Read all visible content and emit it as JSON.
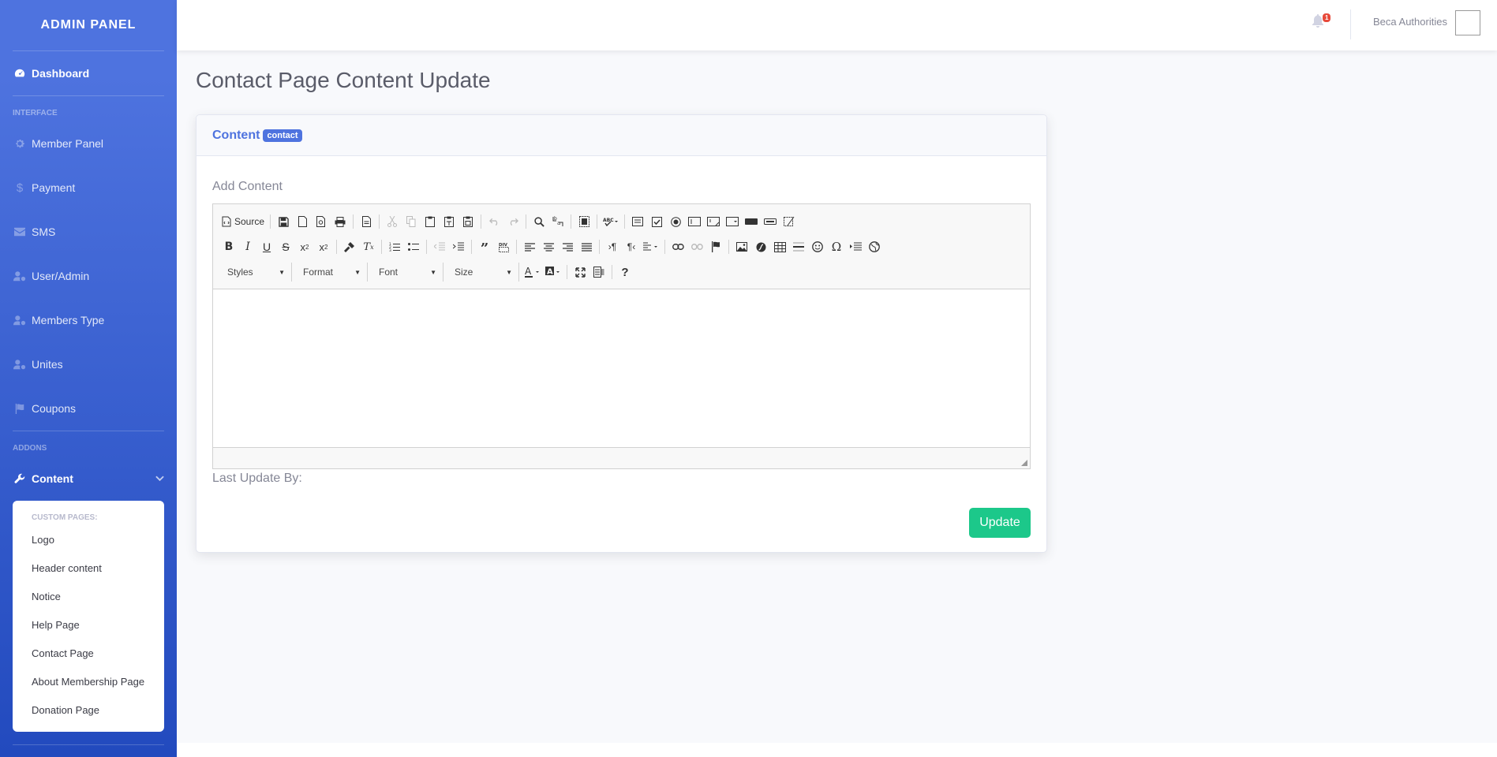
{
  "sidebar": {
    "brand": "ADMIN PANEL",
    "dashboard": "Dashboard",
    "heading_interface": "INTERFACE",
    "items": [
      {
        "label": "Member Panel",
        "icon": "gear-icon"
      },
      {
        "label": "Payment",
        "icon": "dollar-icon"
      },
      {
        "label": "SMS",
        "icon": "envelope-icon"
      },
      {
        "label": "User/Admin",
        "icon": "user-cog-icon"
      },
      {
        "label": "Members Type",
        "icon": "user-cog-icon"
      },
      {
        "label": "Unites",
        "icon": "user-cog-icon"
      },
      {
        "label": "Coupons",
        "icon": "flag-icon"
      }
    ],
    "heading_addons": "ADDONS",
    "content": "Content",
    "collapse": {
      "header": "CUSTOM PAGES:",
      "items": [
        "Logo",
        "Header content",
        "Notice",
        "Help Page",
        "Contact Page",
        "About Membership Page",
        "Donation Page"
      ]
    }
  },
  "topbar": {
    "badge_count": "1",
    "username": "Beca Authorities"
  },
  "page": {
    "title": "Contact Page Content Update"
  },
  "card": {
    "title": "Content",
    "badge": "contact",
    "field_label": "Add Content",
    "last_update": "Last Update By:",
    "update_button": "Update"
  },
  "editor": {
    "source_label": "Source",
    "combos": [
      "Styles",
      "Format",
      "Font",
      "Size"
    ],
    "help": "?"
  },
  "colors": {
    "primary": "#4e73df",
    "success": "#1cc88a",
    "danger": "#e74a3b"
  }
}
